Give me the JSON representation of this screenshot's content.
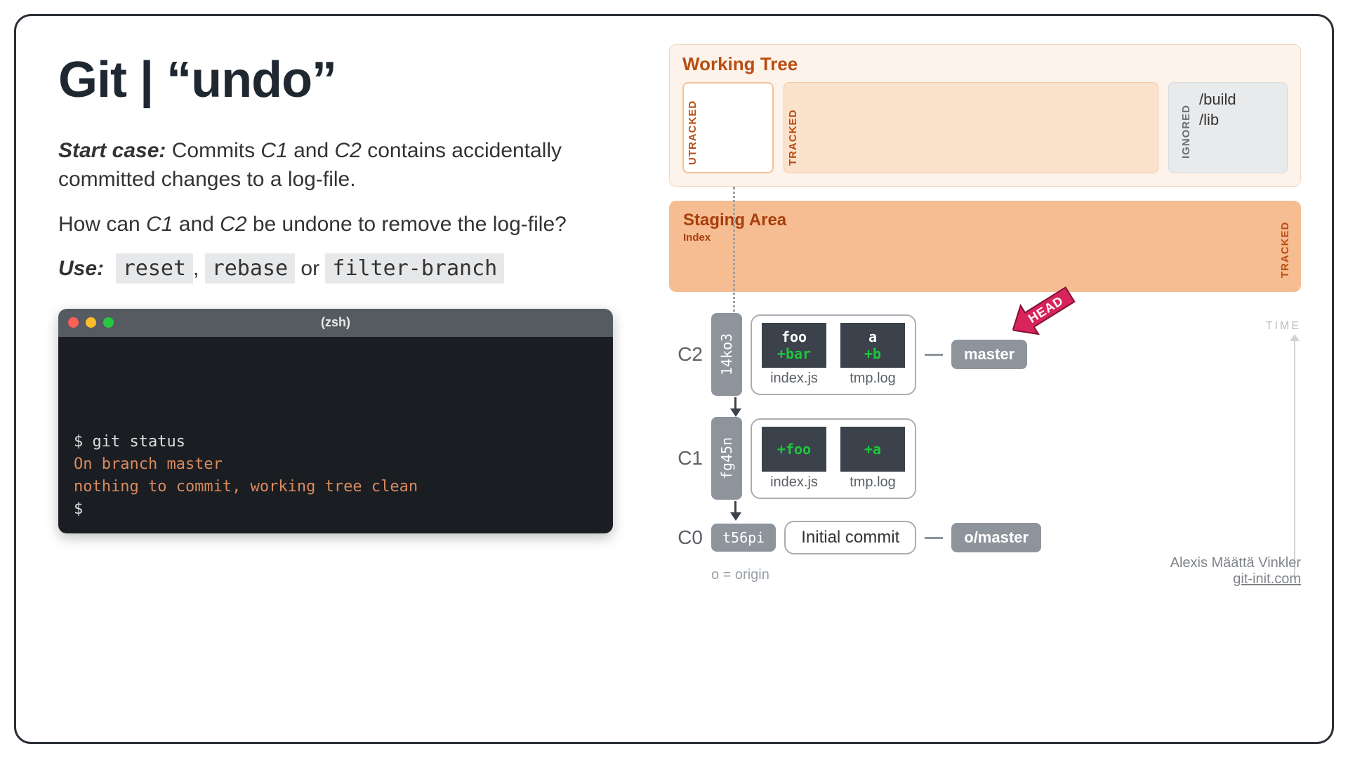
{
  "title": "Git | “undo”",
  "start_case_label": "Start case:",
  "start_case_text_1": " Commits ",
  "start_case_c1": "C1",
  "start_case_text_2": " and ",
  "start_case_c2": "C2",
  "start_case_text_3": " contains accidentally committed changes to a log-file.",
  "question_text_1": "How can ",
  "question_c1": "C1",
  "question_text_2": " and ",
  "question_c2": "C2",
  "question_text_3": " be undone to remove the log-file?",
  "use_label": "Use:",
  "cmd1": "reset",
  "cmd2": "rebase",
  "cmd3": "filter-branch",
  "sep_comma": ", ",
  "sep_or": " or ",
  "terminal": {
    "title": "(zsh)",
    "line1": "$ git status",
    "line2": "On branch master",
    "line3": "nothing to commit, working tree clean",
    "line4": "$"
  },
  "working_tree": {
    "title": "Working Tree",
    "utracked": "UTRACKED",
    "tracked": "TRACKED",
    "ignored": "IGNORED",
    "ignored_items": "/build\n/lib"
  },
  "staging": {
    "title": "Staging Area",
    "sub": "Index",
    "tracked": "TRACKED"
  },
  "commits": {
    "c2": {
      "label": "C2",
      "hash": "14ko3",
      "file1_top": "foo",
      "file1_add": "+bar",
      "file1_name": "index.js",
      "file2_top": "a",
      "file2_add": "+b",
      "file2_name": "tmp.log",
      "branch": "master",
      "head": "HEAD"
    },
    "c1": {
      "label": "C1",
      "hash": "fg45n",
      "file1_add": "+foo",
      "file1_name": "index.js",
      "file2_add": "+a",
      "file2_name": "tmp.log"
    },
    "c0": {
      "label": "C0",
      "hash": "t56pi",
      "msg": "Initial commit",
      "branch": "o/master"
    }
  },
  "time_label": "TIME",
  "origin_note": "o = origin",
  "credits": {
    "author": "Alexis Määttä Vinkler",
    "site": "git-init.com"
  }
}
